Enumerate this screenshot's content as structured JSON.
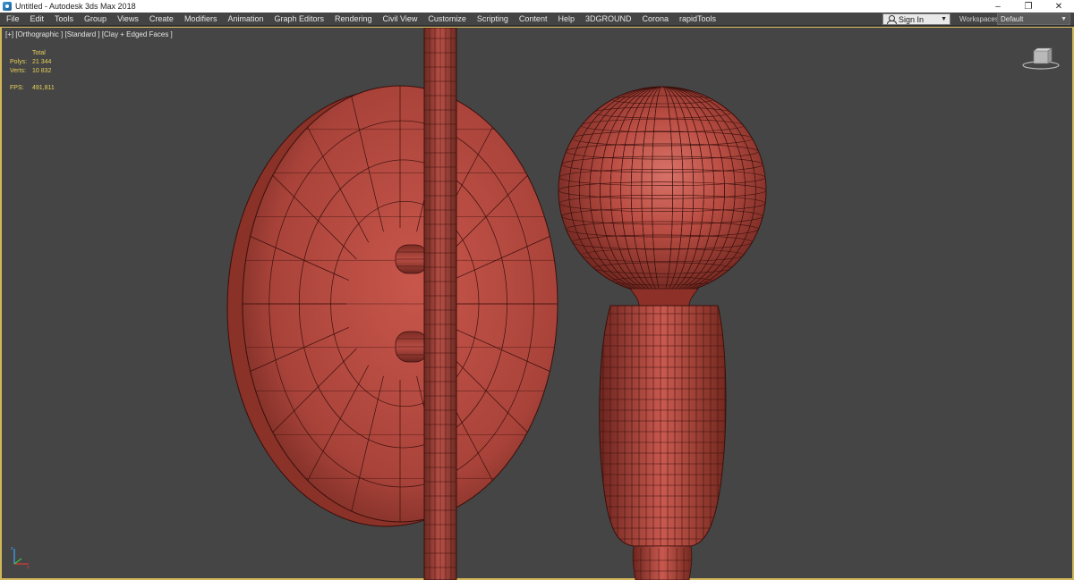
{
  "window": {
    "title": "Untitled - Autodesk 3ds Max 2018",
    "controls": [
      "–",
      "❐",
      "✕"
    ]
  },
  "menu": {
    "items": [
      "File",
      "Edit",
      "Tools",
      "Group",
      "Views",
      "Create",
      "Modifiers",
      "Animation",
      "Graph Editors",
      "Rendering",
      "Civil View",
      "Customize",
      "Scripting",
      "Content",
      "Help",
      "3DGROUND",
      "Corona",
      "rapidTools"
    ],
    "signin_label": "Sign In",
    "workspaces_label": "Workspaces:",
    "workspace_value": "Default"
  },
  "viewport": {
    "label": "[+] [Orthographic ] [Standard ] [Clay + Edged Faces ]",
    "stats": {
      "header": "Total",
      "polys_label": "Polys:",
      "polys_value": "21 344",
      "verts_label": "Verts:",
      "verts_value": "10 832",
      "fps_label": "FPS:",
      "fps_value": "491,811"
    }
  },
  "colors": {
    "clay": "#b5473e",
    "clay_dark": "#7a2820",
    "wire": "#3a100c",
    "viewport_border": "#d1b75a",
    "stats_text": "#e6d15a"
  }
}
